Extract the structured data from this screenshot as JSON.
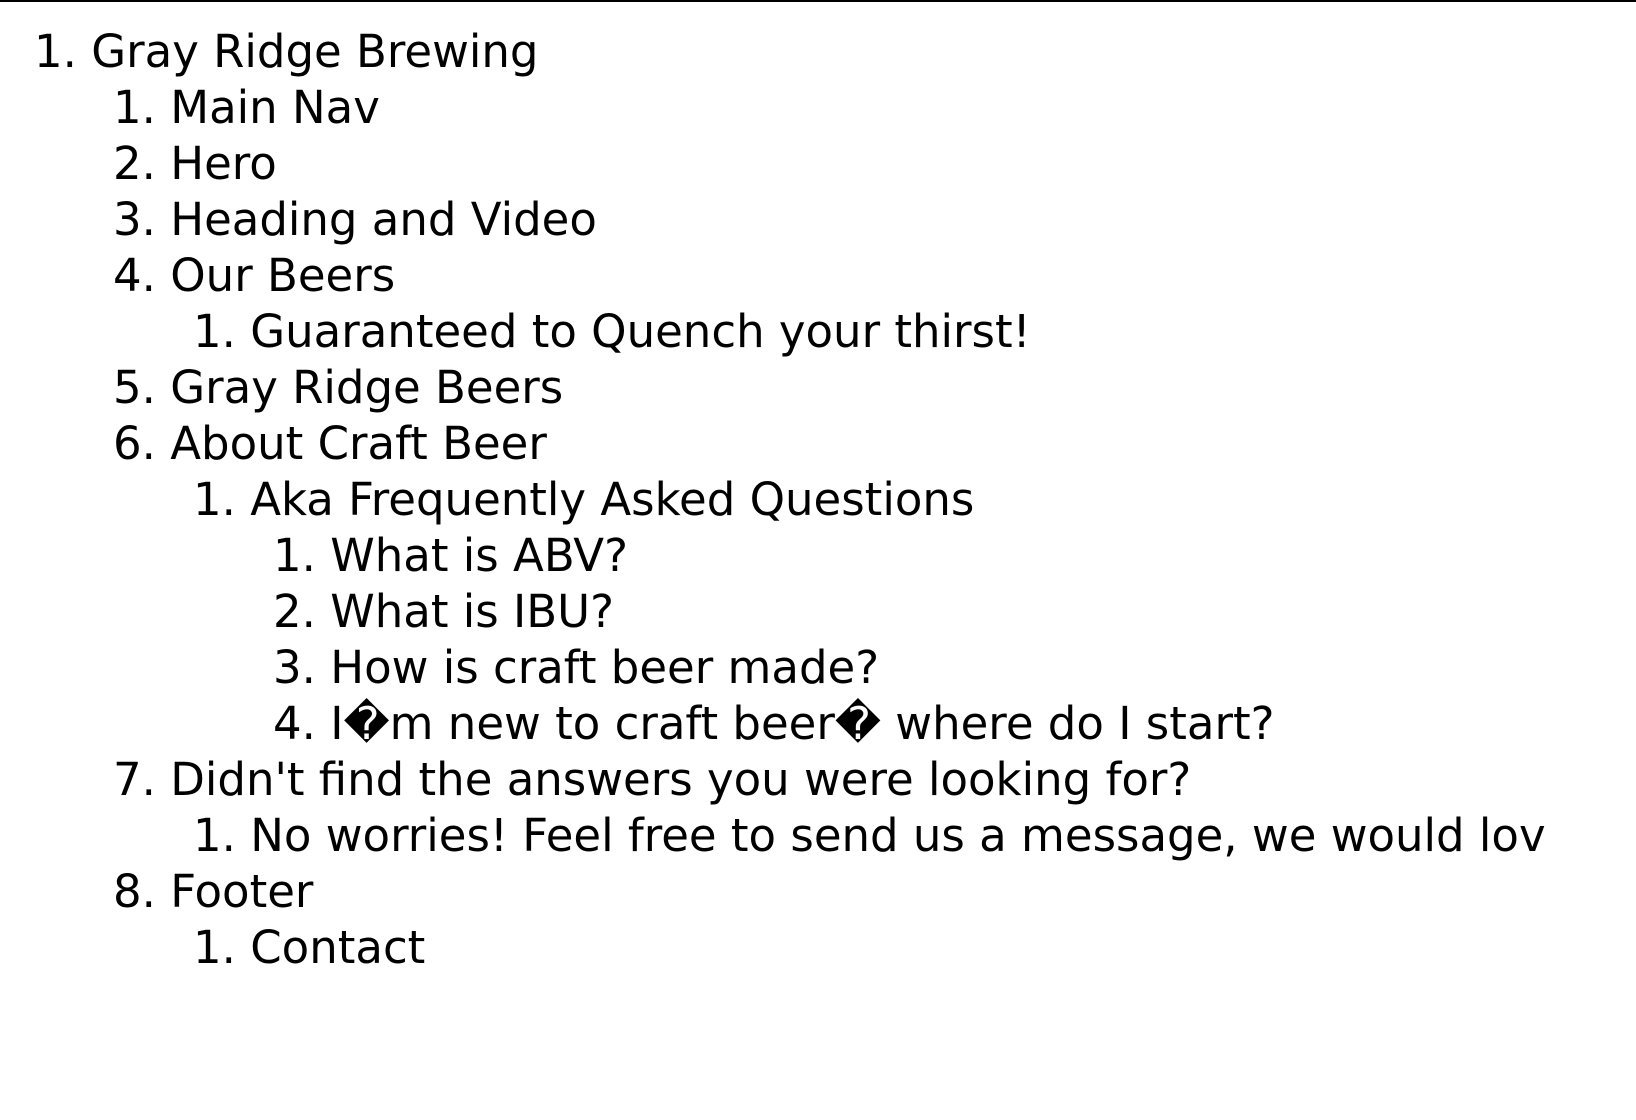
{
  "outline": [
    {
      "number": "1.",
      "text": "Gray Ridge Brewing",
      "level": 0
    },
    {
      "number": "1.",
      "text": "Main Nav",
      "level": 1
    },
    {
      "number": "2.",
      "text": "Hero",
      "level": 1
    },
    {
      "number": "3.",
      "text": "Heading and Video",
      "level": 1
    },
    {
      "number": "4.",
      "text": "Our Beers",
      "level": 1
    },
    {
      "number": "1.",
      "text": "Guaranteed to Quench your thirst!",
      "level": 2
    },
    {
      "number": "5.",
      "text": "Gray Ridge Beers",
      "level": 1
    },
    {
      "number": "6.",
      "text": "About Craft Beer",
      "level": 1
    },
    {
      "number": "1.",
      "text": "Aka Frequently Asked Questions",
      "level": 2
    },
    {
      "number": "1.",
      "text": "What is ABV?",
      "level": 3
    },
    {
      "number": "2.",
      "text": "What is IBU?",
      "level": 3
    },
    {
      "number": "3.",
      "text": "How is craft beer made?",
      "level": 3
    },
    {
      "number": "4.",
      "text": "I�m new to craft beer� where do I start?",
      "level": 3
    },
    {
      "number": "7.",
      "text": "Didn't find the answers you were looking for?",
      "level": 1
    },
    {
      "number": "1.",
      "text": "No worries! Feel free to send us a message, we would lov",
      "level": 2
    },
    {
      "number": "8.",
      "text": "Footer",
      "level": 1
    },
    {
      "number": "1.",
      "text": "Contact",
      "level": 2
    }
  ]
}
